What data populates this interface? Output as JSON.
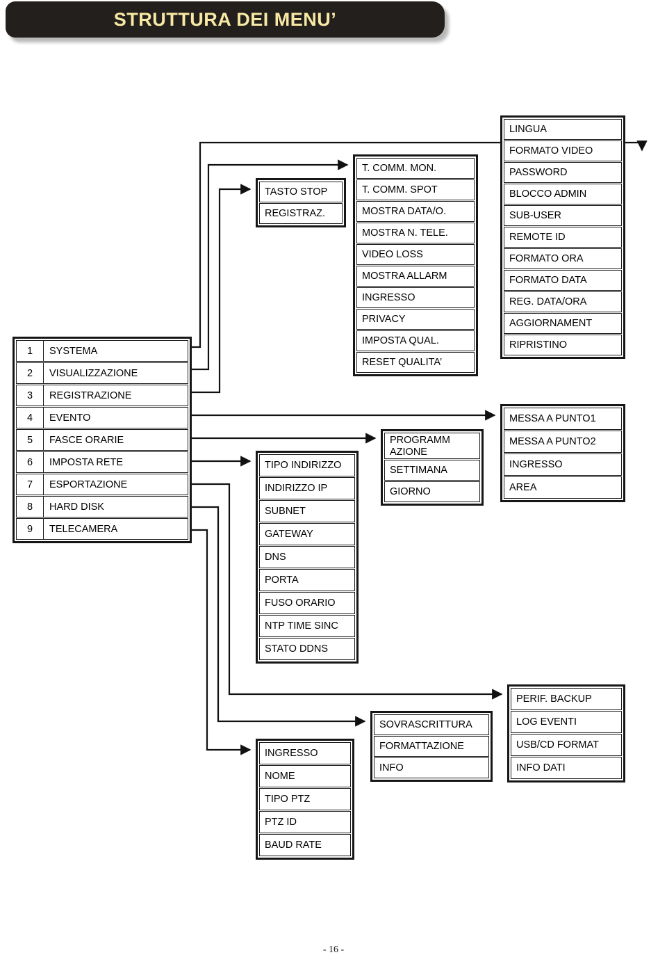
{
  "page": {
    "title": "STRUTTURA DEI MENU’",
    "number": "- 16 -",
    "accent_text_color": "#f7e9a4",
    "banner_color": "#231f1c"
  },
  "main_menu": {
    "name": "main-menu",
    "items": [
      {
        "index": "1",
        "label": "SYSTEMA"
      },
      {
        "index": "2",
        "label": "VISUALIZZAZIONE"
      },
      {
        "index": "3",
        "label": "REGISTRAZIONE"
      },
      {
        "index": "4",
        "label": "EVENTO"
      },
      {
        "index": "5",
        "label": "FASCE ORARIE"
      },
      {
        "index": "6",
        "label": "IMPOSTA RETE"
      },
      {
        "index": "7",
        "label": "ESPORTAZIONE"
      },
      {
        "index": "8",
        "label": "HARD DISK"
      },
      {
        "index": "9",
        "label": "TELECAMERA"
      }
    ]
  },
  "system_menu": {
    "items": [
      {
        "label": "LINGUA"
      },
      {
        "label": "FORMATO VIDEO"
      },
      {
        "label": "PASSWORD"
      },
      {
        "label": "BLOCCO ADMIN"
      },
      {
        "label": "SUB-USER"
      },
      {
        "label": "REMOTE ID"
      },
      {
        "label": "FORMATO ORA"
      },
      {
        "label": "FORMATO DATA"
      },
      {
        "label": "REG. DATA/ORA"
      },
      {
        "label": "AGGIORNAMENT"
      },
      {
        "label": "RIPRISTINO"
      }
    ]
  },
  "visual_menu": {
    "items": [
      {
        "label": "T. COMM. MON."
      },
      {
        "label": "T. COMM. SPOT"
      },
      {
        "label": "MOSTRA DATA/O."
      },
      {
        "label": "MOSTRA N. TELE."
      },
      {
        "label": "VIDEO LOSS"
      },
      {
        "label": "MOSTRA ALLARM"
      },
      {
        "label": "INGRESSO"
      },
      {
        "label": "PRIVACY"
      },
      {
        "label": "IMPOSTA QUAL."
      },
      {
        "label": "RESET QUALITA’"
      }
    ]
  },
  "record_menu": {
    "items": [
      {
        "label": "TASTO STOP"
      },
      {
        "label": "REGISTRAZ."
      }
    ]
  },
  "event_menu": {
    "items": [
      {
        "label": "MESSA A PUNTO1"
      },
      {
        "label": "MESSA A PUNTO2"
      },
      {
        "label": "INGRESSO"
      },
      {
        "label": "AREA"
      }
    ]
  },
  "schedule_menu": {
    "items": [
      {
        "label": "PROGRAMM AZIONE"
      },
      {
        "label": "SETTIMANA"
      },
      {
        "label": "GIORNO"
      }
    ]
  },
  "network_menu": {
    "items": [
      {
        "label": "TIPO INDIRIZZO"
      },
      {
        "label": "INDIRIZZO IP"
      },
      {
        "label": "SUBNET"
      },
      {
        "label": "GATEWAY"
      },
      {
        "label": "DNS"
      },
      {
        "label": "PORTA"
      },
      {
        "label": "FUSO ORARIO"
      },
      {
        "label": "NTP TIME SINC"
      },
      {
        "label": "STATO DDNS"
      }
    ]
  },
  "harddisk_menu": {
    "items": [
      {
        "label": "SOVRASCRITTURA"
      },
      {
        "label": "FORMATTAZIONE"
      },
      {
        "label": "INFO"
      }
    ]
  },
  "export_menu": {
    "items": [
      {
        "label": "PERIF. BACKUP"
      },
      {
        "label": "LOG EVENTI"
      },
      {
        "label": "USB/CD FORMAT"
      },
      {
        "label": "INFO DATI"
      }
    ]
  },
  "camera_menu": {
    "items": [
      {
        "label": "INGRESSO"
      },
      {
        "label": "NOME"
      },
      {
        "label": "TIPO PTZ"
      },
      {
        "label": "PTZ ID"
      },
      {
        "label": "BAUD RATE"
      }
    ]
  }
}
